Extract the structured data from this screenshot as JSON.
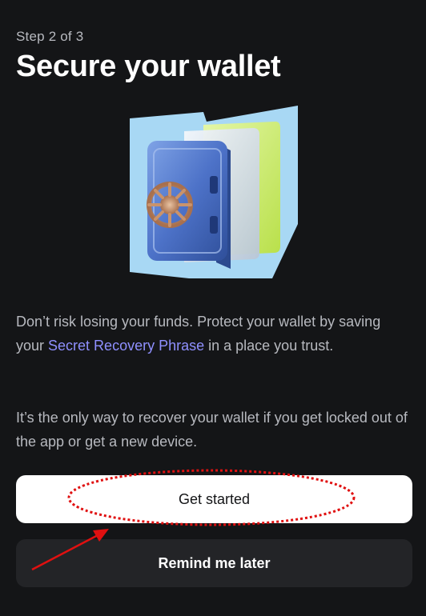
{
  "header": {
    "step": "Step 2 of 3",
    "title": "Secure your wallet"
  },
  "body": {
    "p1_before": "Don’t risk losing your funds. Protect your wallet by saving your ",
    "p1_link": "Secret Recovery Phrase",
    "p1_after": " in a place you trust.",
    "p2": "It’s the only way to recover your wallet if you get locked out of the app or get a new device."
  },
  "actions": {
    "primary_label": "Get started",
    "secondary_label": "Remind me later"
  },
  "colors": {
    "background": "#141517",
    "link": "#8f90ff",
    "annotation": "#e01010"
  },
  "icons": {
    "illustration": "safe-illustration"
  }
}
